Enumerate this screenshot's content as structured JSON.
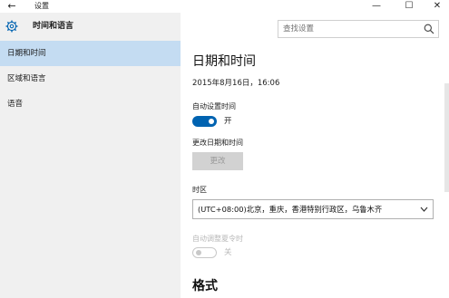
{
  "window": {
    "title": "设置",
    "back_glyph": "←",
    "minimize_glyph": "—",
    "maximize_glyph": "☐",
    "close_glyph": "✕"
  },
  "sidebar": {
    "header": "时间和语言",
    "items": [
      {
        "label": "日期和时间",
        "active": true
      },
      {
        "label": "区域和语言",
        "active": false
      },
      {
        "label": "语音",
        "active": false
      }
    ]
  },
  "search": {
    "placeholder": "查找设置"
  },
  "main": {
    "title": "日期和时间",
    "current_datetime": "2015年8月16日，16:06",
    "auto_time": {
      "label": "自动设置时间",
      "state_label": "开",
      "on": true
    },
    "change": {
      "label": "更改日期和时间",
      "button": "更改"
    },
    "timezone": {
      "label": "时区",
      "value": "(UTC+08:00)北京，重庆，香港特别行政区，乌鲁木齐"
    },
    "dst": {
      "label": "自动调整夏令时",
      "state_label": "关",
      "on": false
    },
    "format_title": "格式"
  },
  "colors": {
    "accent": "#0063b1",
    "sidebar_bg": "#f0f0f0",
    "active_item_bg": "#c4dcf2"
  }
}
